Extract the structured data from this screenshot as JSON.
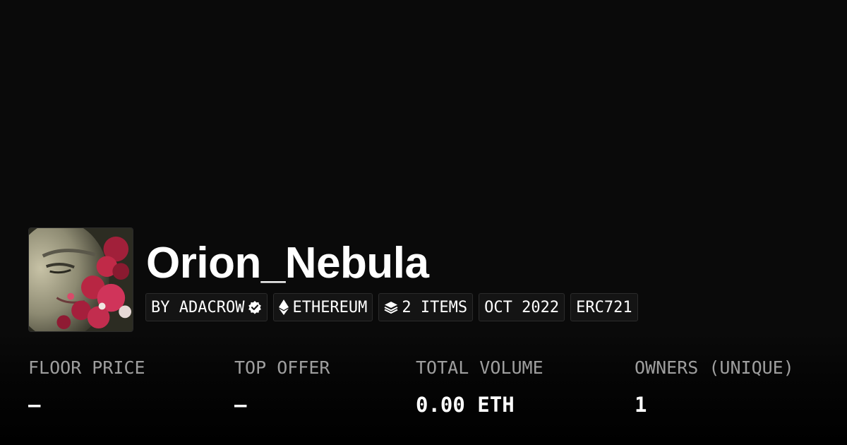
{
  "collection": {
    "name": "Orion_Nebula",
    "avatar_alt": "collection avatar"
  },
  "badges": {
    "creator": "BY ADACROW",
    "creator_verified_icon": "verified-check-icon",
    "chain": "ETHEREUM",
    "chain_icon": "ethereum-icon",
    "items": "2 ITEMS",
    "items_icon": "layers-icon",
    "created": "OCT 2022",
    "standard": "ERC721"
  },
  "stats": [
    {
      "label": "FLOOR PRICE",
      "value": "–"
    },
    {
      "label": "TOP OFFER",
      "value": "–"
    },
    {
      "label": "TOTAL VOLUME",
      "value": "0.00 ETH"
    },
    {
      "label": "OWNERS (UNIQUE)",
      "value": "1"
    }
  ],
  "colors": {
    "background": "#0a0a0a",
    "badge_bg": "#141414",
    "badge_border": "#2b2b2b",
    "label": "#9e9e9e",
    "text": "#ffffff"
  }
}
